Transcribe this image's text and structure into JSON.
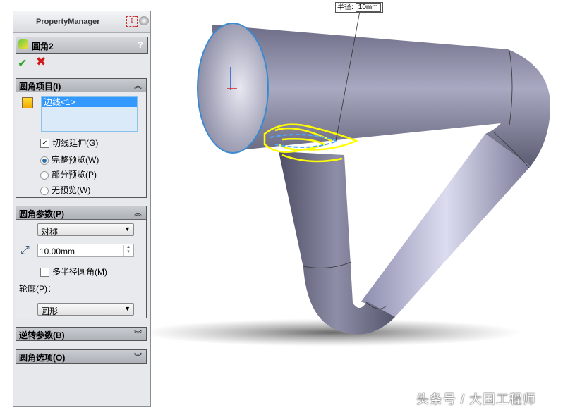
{
  "property_manager": {
    "title": "PropertyManager",
    "feature_name": "圆角2",
    "help": "?",
    "ok_icon": "check-icon",
    "cancel_icon": "close-icon"
  },
  "fillet_items": {
    "header": "圆角项目(I)",
    "edge": "边线<1>",
    "tangent_propagation": "切线延伸(G)",
    "tangent_checked": true,
    "preview_options": [
      {
        "label": "完整预览(W)",
        "selected": true
      },
      {
        "label": "部分预览(P)",
        "selected": false
      },
      {
        "label": "无预览(W)",
        "selected": false
      }
    ]
  },
  "fillet_params": {
    "header": "圆角参数(P)",
    "type": "对称",
    "radius": "10.00mm",
    "multi_radius": "多半径圆角(M)",
    "multi_checked": false,
    "profile_label": "轮廓(P)：",
    "profile": "圆形"
  },
  "setback": {
    "header": "逆转参数(B)"
  },
  "fillet_options": {
    "header": "圆角选项(O)"
  },
  "viewport": {
    "dim_label": "半径:",
    "dim_value": "10mm",
    "watermark": "头条号 / 大国工程师"
  },
  "colors": {
    "part": "#8a8aa8",
    "highlight": "#ffff00",
    "accent": "#3399ff"
  }
}
